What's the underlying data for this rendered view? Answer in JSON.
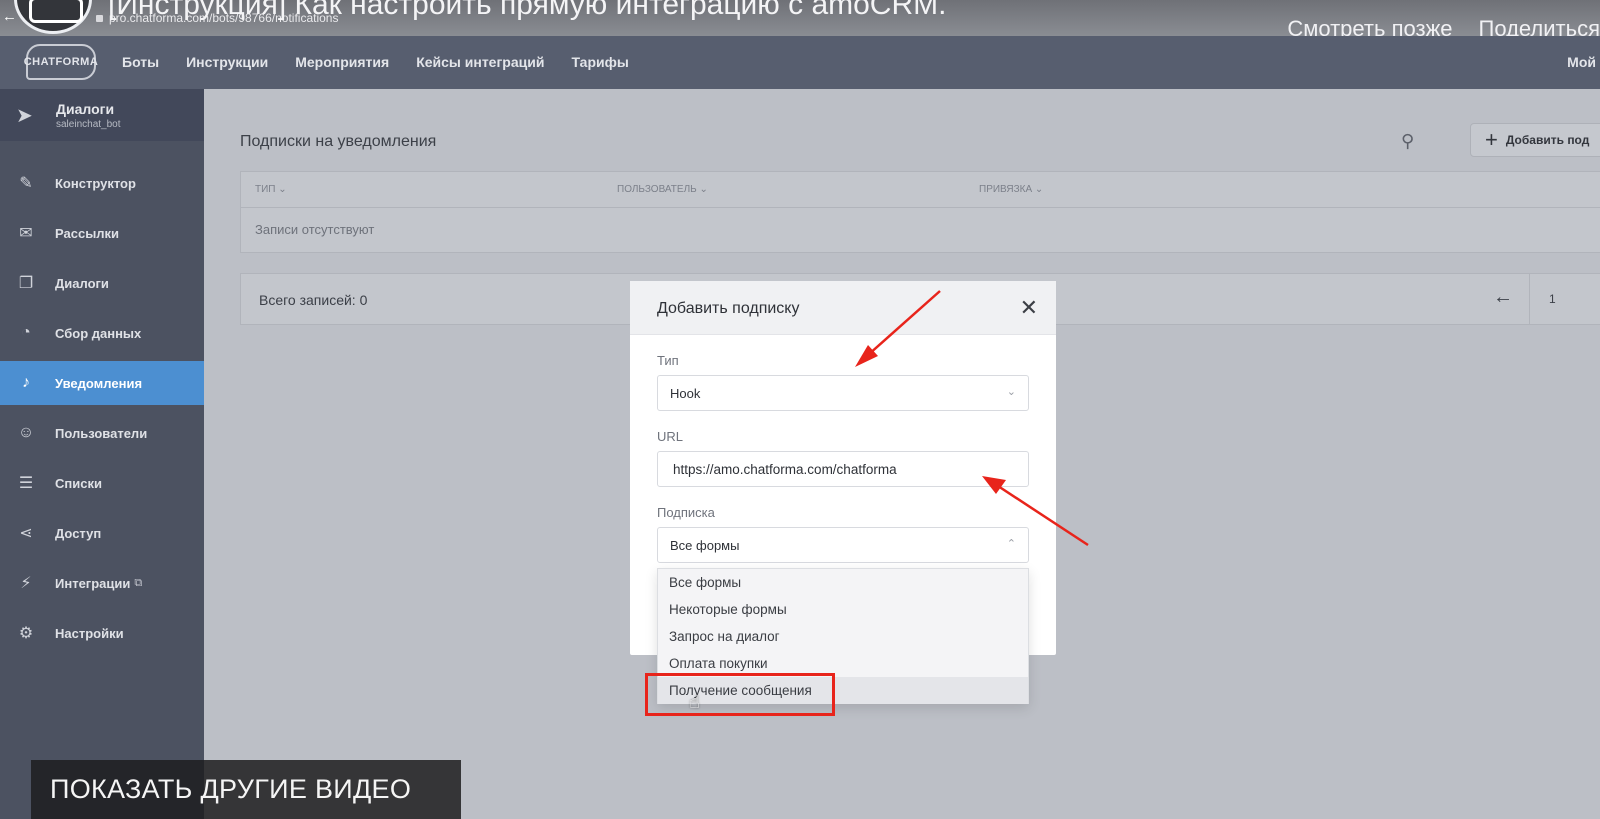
{
  "video": {
    "title": "[Инструкция] Как настроить прямую интеграцию с amoCRM.",
    "watch_later": "Смотреть позже",
    "share": "Поделиться",
    "more_videos": "ПОКАЗАТЬ ДРУГИЕ ВИДЕО"
  },
  "browser": {
    "url": "pro.chatforma.com/bots/98766/notifications"
  },
  "header": {
    "logo": "CHATFORMA",
    "nav": [
      "Боты",
      "Инструкции",
      "Мероприятия",
      "Кейсы интеграций",
      "Тарифы"
    ],
    "account": "Мой"
  },
  "sidebar": {
    "bot_name": "Диалоги",
    "bot_handle": "saleinchat_bot",
    "items": [
      {
        "label": "Конструктор",
        "icon": "wrench-icon"
      },
      {
        "label": "Рассылки",
        "icon": "envelope-icon"
      },
      {
        "label": "Диалоги",
        "icon": "chat-icon"
      },
      {
        "label": "Сбор данных",
        "icon": "pie-icon"
      },
      {
        "label": "Уведомления",
        "icon": "bell-icon",
        "active": true
      },
      {
        "label": "Пользователи",
        "icon": "users-icon"
      },
      {
        "label": "Списки",
        "icon": "list-icon"
      },
      {
        "label": "Доступ",
        "icon": "share-icon"
      },
      {
        "label": "Интеграции",
        "icon": "plug-icon"
      },
      {
        "label": "Настройки",
        "icon": "gear-icon"
      }
    ]
  },
  "main": {
    "title": "Подписки на уведомления",
    "add_button": "Добавить под",
    "columns": [
      "ТИП",
      "ПОЛЬЗОВАТЕЛЬ",
      "ПРИВЯЗКА"
    ],
    "empty_text": "Записи отсутствуют",
    "total": "Всего записей: 0",
    "page": "1"
  },
  "modal": {
    "title": "Добавить подписку",
    "type_label": "Тип",
    "type_value": "Hook",
    "url_label": "URL",
    "url_value": "https://amo.chatforma.com/chatforma",
    "subscription_label": "Подписка",
    "subscription_value": "Все формы",
    "options": [
      "Все формы",
      "Некоторые формы",
      "Запрос на диалог",
      "Оплата покупки",
      "Получение сообщения"
    ]
  },
  "colors": {
    "accent": "#4c8fd1",
    "annotation": "#e8241b"
  }
}
